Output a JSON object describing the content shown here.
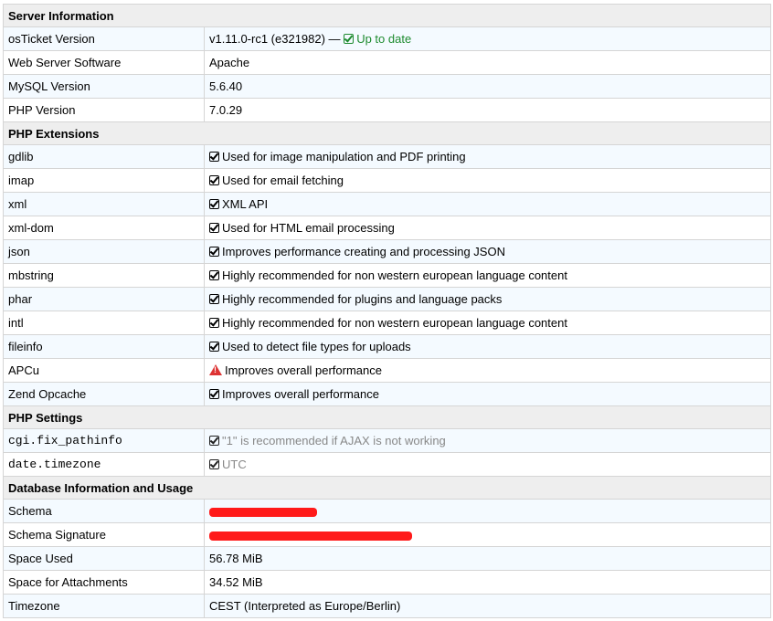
{
  "sections": {
    "server": {
      "title": "Server Information",
      "rows": [
        {
          "label": "osTicket Version",
          "value": "v1.11.0-rc1 (e321982) —",
          "status": "Up to date"
        },
        {
          "label": "Web Server Software",
          "value": "Apache"
        },
        {
          "label": "MySQL Version",
          "value": "5.6.40"
        },
        {
          "label": "PHP Version",
          "value": "7.0.29"
        }
      ]
    },
    "extensions": {
      "title": "PHP Extensions",
      "rows": [
        {
          "label": "gdlib",
          "value": "Used for image manipulation and PDF printing",
          "icon": "check-icon"
        },
        {
          "label": "imap",
          "value": "Used for email fetching",
          "icon": "check-icon"
        },
        {
          "label": "xml",
          "value": "XML API",
          "icon": "check-icon"
        },
        {
          "label": "xml-dom",
          "value": "Used for HTML email processing",
          "icon": "check-icon"
        },
        {
          "label": "json",
          "value": "Improves performance creating and processing JSON",
          "icon": "check-icon"
        },
        {
          "label": "mbstring",
          "value": "Highly recommended for non western european language content",
          "icon": "check-icon"
        },
        {
          "label": "phar",
          "value": "Highly recommended for plugins and language packs",
          "icon": "check-icon"
        },
        {
          "label": "intl",
          "value": "Highly recommended for non western european language content",
          "icon": "check-icon"
        },
        {
          "label": "fileinfo",
          "value": "Used to detect file types for uploads",
          "icon": "check-icon"
        },
        {
          "label": "APCu",
          "value": "Improves overall performance",
          "icon": "warning-icon"
        },
        {
          "label": "Zend Opcache",
          "value": "Improves overall performance",
          "icon": "check-icon"
        }
      ]
    },
    "settings": {
      "title": "PHP Settings",
      "rows": [
        {
          "label": "cgi.fix_pathinfo",
          "value": "\"1\" is recommended if AJAX is not working",
          "icon": "check-icon"
        },
        {
          "label": "date.timezone",
          "value": "UTC",
          "icon": "check-icon"
        }
      ]
    },
    "database": {
      "title": "Database Information and Usage",
      "rows": [
        {
          "label": "Schema",
          "value": ""
        },
        {
          "label": "Schema Signature",
          "value": ""
        },
        {
          "label": "Space Used",
          "value": "56.78 MiB"
        },
        {
          "label": "Space for Attachments",
          "value": "34.52 MiB"
        },
        {
          "label": "Timezone",
          "value": "CEST (Interpreted as Europe/Berlin)"
        }
      ]
    }
  },
  "colors": {
    "ok": "#1e8b2f",
    "warning": "#dd3333",
    "redaction": "#ff1a1a",
    "row_alt": "#f4faff"
  }
}
